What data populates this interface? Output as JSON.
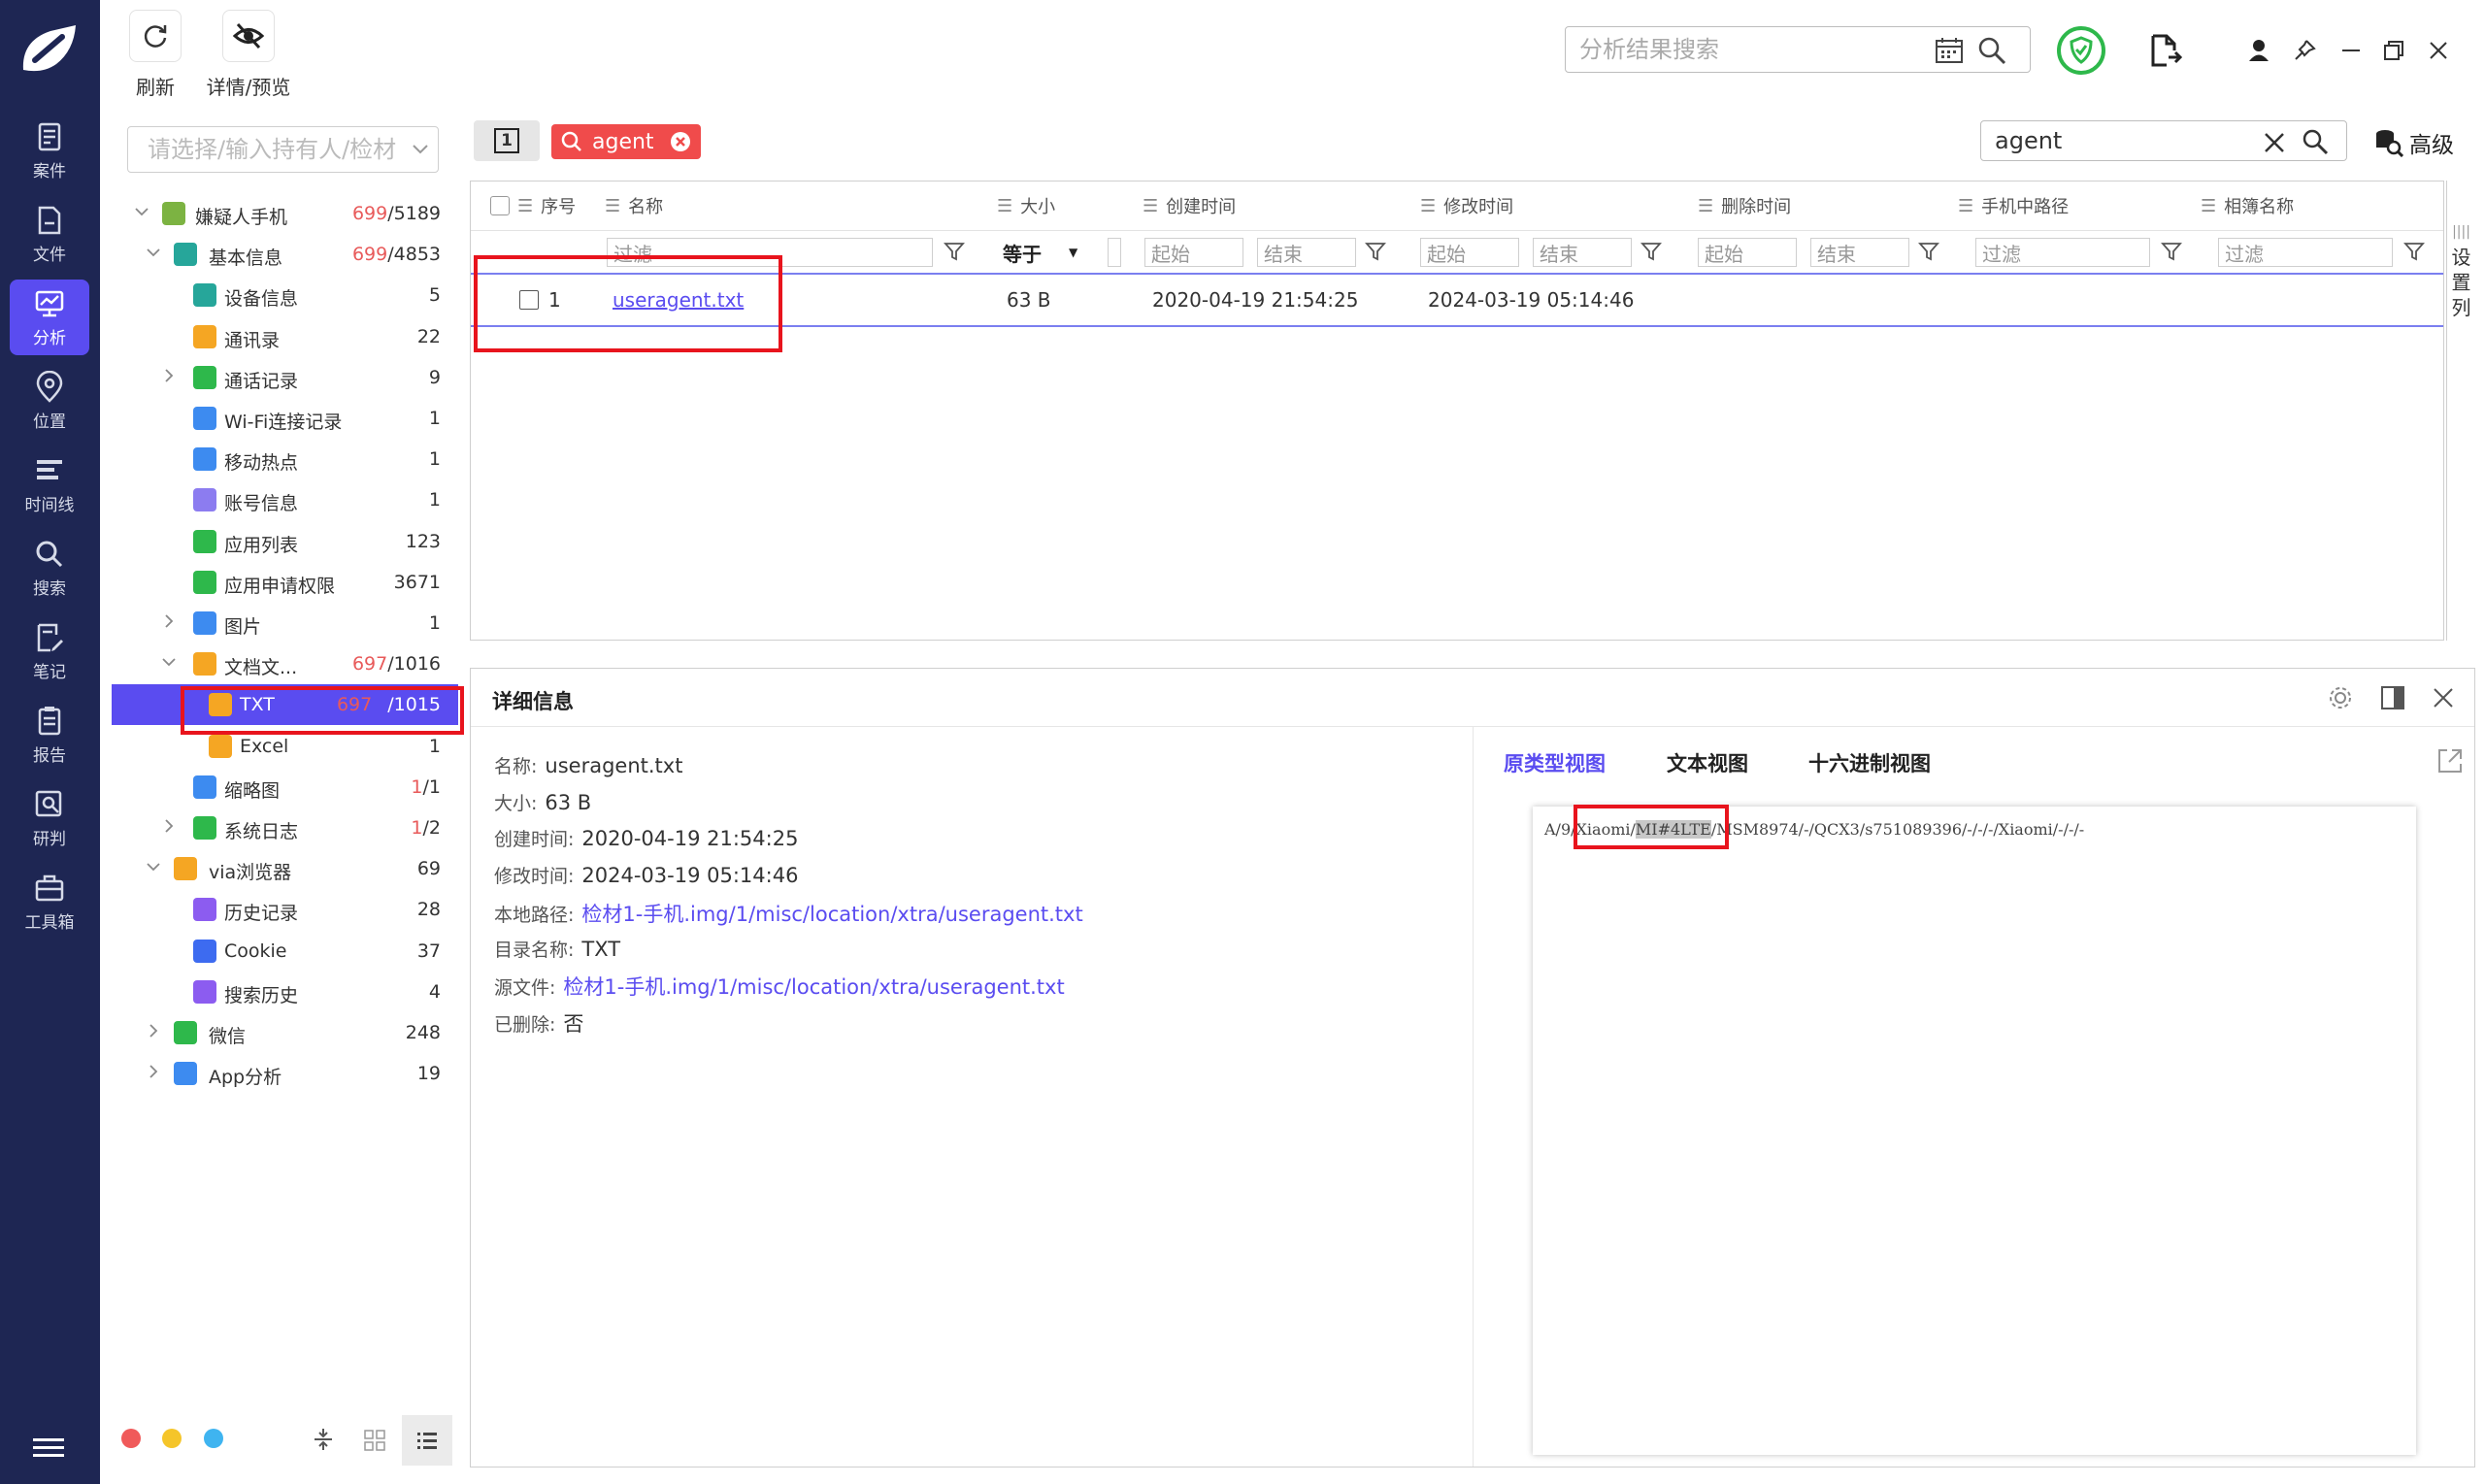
{
  "nav": {
    "items": [
      {
        "id": "case",
        "label": "案件"
      },
      {
        "id": "file",
        "label": "文件"
      },
      {
        "id": "analysis",
        "label": "分析"
      },
      {
        "id": "location",
        "label": "位置"
      },
      {
        "id": "timeline",
        "label": "时间线"
      },
      {
        "id": "search",
        "label": "搜索"
      },
      {
        "id": "notes",
        "label": "笔记"
      },
      {
        "id": "report",
        "label": "报告"
      },
      {
        "id": "judge",
        "label": "研判"
      },
      {
        "id": "toolbox",
        "label": "工具箱"
      }
    ],
    "active": "analysis",
    "accent": "#5a4cf0",
    "background": "#1e2653"
  },
  "toolbar": {
    "refresh_label": "刷新",
    "preview_label": "详情/预览"
  },
  "global_search": {
    "placeholder": "分析结果搜索"
  },
  "tree": {
    "owner_placeholder": "请选择/输入持有人/检材",
    "rows": [
      {
        "name": "嫌疑人手机",
        "count_red": "699",
        "count_total": "/5189",
        "icon": "android-icon"
      },
      {
        "name": "基本信息",
        "count_red": "699",
        "count_total": "/4853",
        "icon": "phone-info-icon"
      },
      {
        "name": "设备信息",
        "count": "5",
        "icon": "device-icon"
      },
      {
        "name": "通讯录",
        "count": "22",
        "icon": "contacts-icon"
      },
      {
        "name": "通话记录",
        "count": "9",
        "icon": "call-icon"
      },
      {
        "name": "Wi-Fi连接记录",
        "count": "1",
        "icon": "wifi-icon"
      },
      {
        "name": "移动热点",
        "count": "1",
        "icon": "hotspot-icon"
      },
      {
        "name": "账号信息",
        "count": "1",
        "icon": "account-icon"
      },
      {
        "name": "应用列表",
        "count": "123",
        "icon": "app-list-icon"
      },
      {
        "name": "应用申请权限",
        "count": "3671",
        "icon": "permission-icon"
      },
      {
        "name": "图片",
        "count": "1",
        "icon": "image-icon"
      },
      {
        "name": "文档文...",
        "count_red": "697",
        "count_total": "/1016",
        "icon": "document-icon"
      },
      {
        "name": "TXT",
        "count_red": "697",
        "count_total": "/1015",
        "icon": "txt-icon"
      },
      {
        "name": "Excel",
        "count": "1",
        "icon": "excel-icon"
      },
      {
        "name": "缩略图",
        "count_red": "1",
        "count_total": "/1",
        "icon": "thumbnail-icon"
      },
      {
        "name": "系统日志",
        "count_red": "1",
        "count_total": "/2",
        "icon": "log-icon"
      },
      {
        "name": "via浏览器",
        "count": "69",
        "icon": "via-browser-icon"
      },
      {
        "name": "历史记录",
        "count": "28",
        "icon": "history-icon"
      },
      {
        "name": "Cookie",
        "count": "37",
        "icon": "cookie-icon"
      },
      {
        "name": "搜索历史",
        "count": "4",
        "icon": "search-history-icon"
      },
      {
        "name": "微信",
        "count": "248",
        "icon": "wechat-icon"
      },
      {
        "name": "App分析",
        "count": "19",
        "icon": "app-analysis-icon"
      }
    ]
  },
  "list": {
    "tab_number": "1",
    "filter_tag": "agent",
    "search_value": "agent",
    "advanced_label": "高级",
    "columns": [
      "序号",
      "名称",
      "大小",
      "创建时间",
      "修改时间",
      "删除时间",
      "手机中路径",
      "相簿名称"
    ],
    "filter_placeholder": "过滤",
    "size_op": "等于",
    "range_start": "起始",
    "range_end": "结束",
    "rows": [
      {
        "index": "1",
        "name": "useragent.txt",
        "size": "63 B",
        "created": "2020-04-19 21:54:25",
        "modified": "2024-03-19 05:14:46",
        "deleted": "",
        "phone_path": "",
        "album": ""
      }
    ],
    "set_columns_label": [
      "设",
      "置",
      "列"
    ]
  },
  "detail": {
    "title": "详细信息",
    "props": [
      {
        "k": "名称:",
        "v": "useragent.txt"
      },
      {
        "k": "大小:",
        "v": "63 B"
      },
      {
        "k": "创建时间:",
        "v": "2020-04-19 21:54:25"
      },
      {
        "k": "修改时间:",
        "v": "2024-03-19 05:14:46"
      },
      {
        "k": "本地路径:",
        "v": "检材1-手机.img/1/misc/location/xtra/useragent.txt",
        "link": true
      },
      {
        "k": "目录名称:",
        "v": "TXT"
      },
      {
        "k": "源文件:",
        "v": "检材1-手机.img/1/misc/location/xtra/useragent.txt",
        "link": true
      },
      {
        "k": "已删除:",
        "v": "否"
      }
    ],
    "view_tabs": [
      "原类型视图",
      "文本视图",
      "十六进制视图"
    ],
    "preview": {
      "pre": "A/9/",
      "p1": "Xiaomi/",
      "hl": "MI#4LTE",
      "post": "/MSM8974/-/QCX3/s751089396/-/-/-/Xiaomi/-/-/-"
    }
  }
}
